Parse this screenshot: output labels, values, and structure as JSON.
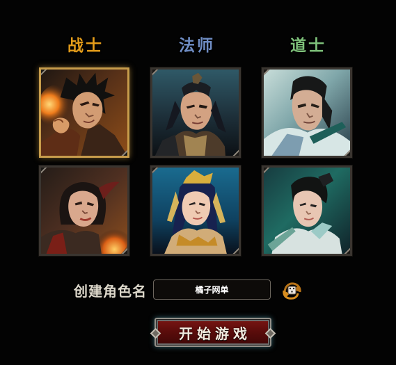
{
  "classes": [
    {
      "title": "战士"
    },
    {
      "title": "法师"
    },
    {
      "title": "道士"
    }
  ],
  "characters": [
    {
      "class": "战士",
      "gender": "male",
      "selected": true
    },
    {
      "class": "法师",
      "gender": "male",
      "selected": false
    },
    {
      "class": "道士",
      "gender": "male",
      "selected": false
    },
    {
      "class": "战士",
      "gender": "female",
      "selected": false
    },
    {
      "class": "法师",
      "gender": "female",
      "selected": false
    },
    {
      "class": "道士",
      "gender": "female",
      "selected": false
    }
  ],
  "create": {
    "label": "创建角色名",
    "name_value": "橘子网单",
    "start_label": "开始游戏",
    "random_icon": "random-dice-icon"
  },
  "colors": {
    "warrior": "#e39c1a",
    "mage": "#6f8dc4",
    "taoist": "#7ec17a",
    "selected_frame": "#c79c4b",
    "start_button": "#6a0f0d"
  }
}
